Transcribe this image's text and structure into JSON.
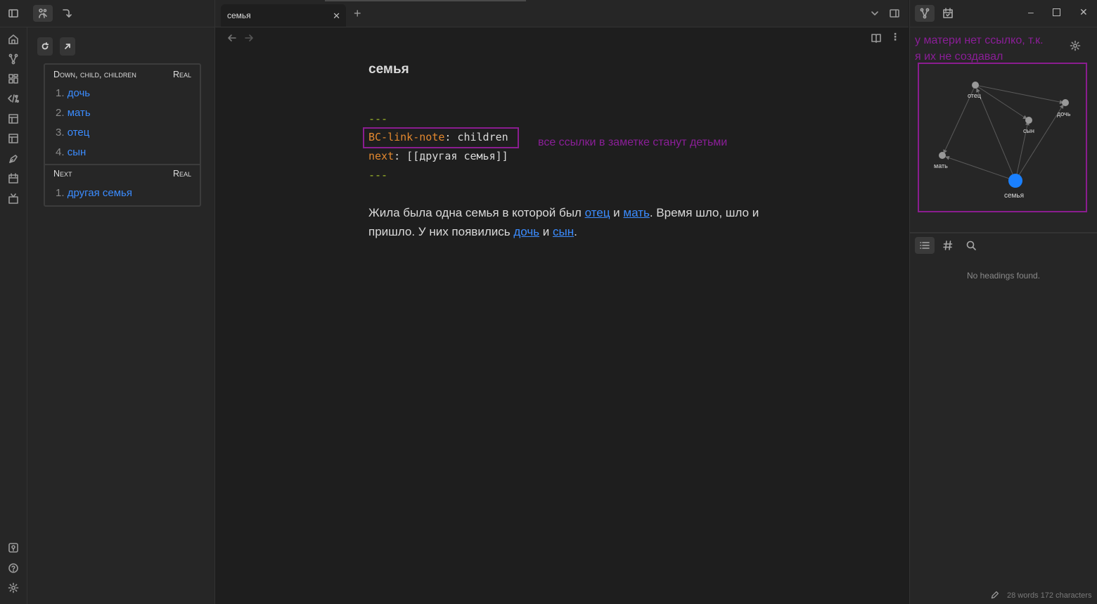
{
  "left_panel": {
    "section_down": {
      "heading": "Down, child, children",
      "type_label": "Real",
      "items": [
        {
          "num": "1.",
          "label": "дочь"
        },
        {
          "num": "2.",
          "label": "мать"
        },
        {
          "num": "3.",
          "label": "отец"
        },
        {
          "num": "4.",
          "label": "сын"
        }
      ]
    },
    "section_next": {
      "heading": "Next",
      "type_label": "Real",
      "items": [
        {
          "num": "1.",
          "label": "другая семья"
        }
      ]
    }
  },
  "tab": {
    "label": "семья",
    "close_glyph": "✕",
    "new_glyph": "+"
  },
  "editor": {
    "title": "семья",
    "frontmatter": {
      "open": "---",
      "line1_key": "BC-link-note",
      "line1_sep": ":",
      "line1_value": " children",
      "line2_key": "next",
      "line2_sep": ":",
      "line2_value": " [[другая семья]]",
      "close": "---"
    },
    "annotation": "все ссылки в заметке станут детьми",
    "body": {
      "t1": "Жила была одна семья в которой был ",
      "link1": "отец",
      "t2": " и ",
      "link2": "мать",
      "t3": ". Время шло, шло и пришло. У них появились ",
      "link3": "дочь",
      "t4": " и ",
      "link4": "сын",
      "t5": "."
    }
  },
  "right_pane": {
    "annotation_line1": "у матери нет ссылко, т.к.",
    "annotation_line2": "я их не создавал",
    "graph_nodes": {
      "otets": "отец",
      "doch": "дочь",
      "syn": "сын",
      "mat": "мать",
      "semya": "семья"
    },
    "no_headings": "No headings found.",
    "status": "28 words  172 characters"
  },
  "colors": {
    "link": "#3b8cff",
    "annotation": "#8a1d8f",
    "frontmatter_key": "#e3882f",
    "frontmatter_dash": "#9fb92a"
  }
}
